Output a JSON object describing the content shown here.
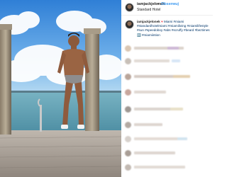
{
  "post": {
    "username": "iamjackjelonek",
    "separator": "•",
    "follow_label": "Obserwuj",
    "location": "Standard Hotel"
  },
  "caption": {
    "username": "iamjackjelonek",
    "heart": "♥",
    "text": "Miami #miami #standardhotelmiami #miamiliving #miamilifestyle #sun #speedoboy #abs #scruffy #beard #beztimes 🔤 #miamiintion"
  },
  "photo": {
    "alt": "Man in grey swim briefs standing on a wooden dock by the water in Miami"
  },
  "comments": {
    "count_visible": 9
  },
  "colors": {
    "link_blue": "#3897f0",
    "hashtag": "#003569",
    "sky": "#3b8ad9",
    "water": "#6aa6b8"
  }
}
